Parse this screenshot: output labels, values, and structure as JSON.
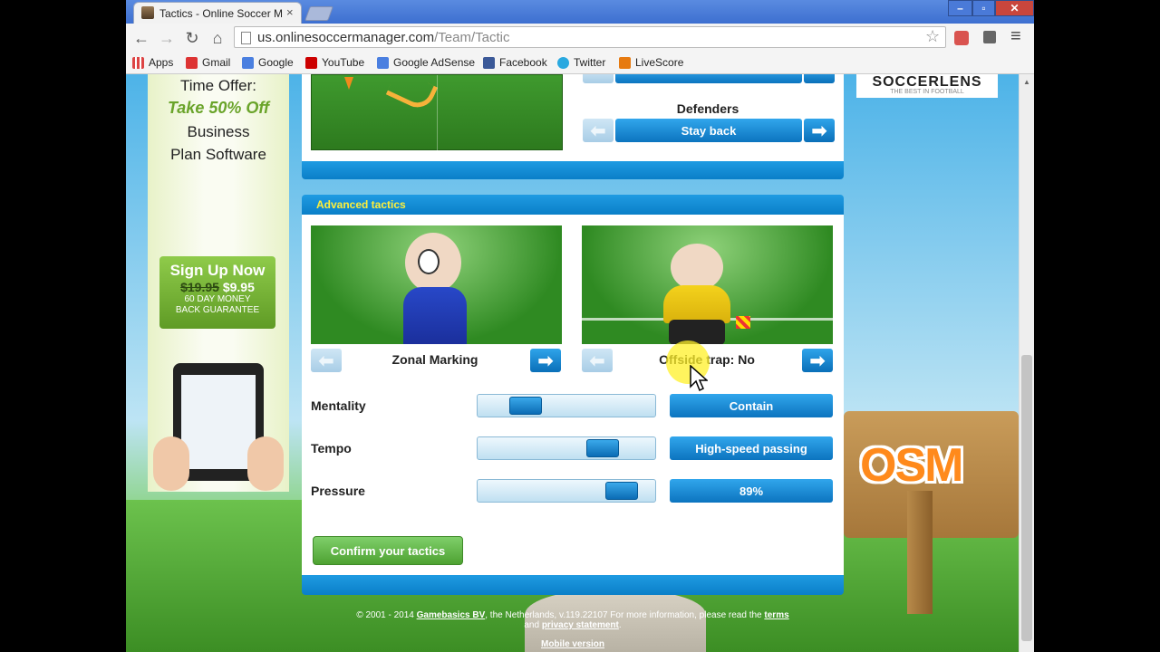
{
  "browser": {
    "tab_title": "Tactics - Online Soccer M",
    "tab_close": "×",
    "url_host": "us.onlinesoccermanager.com",
    "url_path": "/Team/Tactic",
    "win_minimize": "–",
    "win_restore": "▫",
    "win_close": "✕",
    "nav_back": "←",
    "nav_forward": "→",
    "nav_reload": "↻",
    "nav_home": "⌂",
    "star": "☆",
    "menu": "≡",
    "bookmarks": [
      {
        "label": "Apps",
        "icon": "apps-icon",
        "color": "#d44"
      },
      {
        "label": "Gmail",
        "icon": "gmail-icon",
        "color": "#d33"
      },
      {
        "label": "Google",
        "icon": "google-icon",
        "color": "#4a7fe0"
      },
      {
        "label": "YouTube",
        "icon": "youtube-icon",
        "color": "#c00"
      },
      {
        "label": "Google AdSense",
        "icon": "adsense-icon",
        "color": "#4a7fe0"
      },
      {
        "label": "Facebook",
        "icon": "facebook-icon",
        "color": "#3b5998"
      },
      {
        "label": "Twitter",
        "icon": "twitter-icon",
        "color": "#2aa9e0"
      },
      {
        "label": "LiveScore",
        "icon": "livescore-icon",
        "color": "#e67a10"
      }
    ]
  },
  "ad": {
    "line1": "Time Offer:",
    "line2": "Take 50% Off",
    "line3": "Business",
    "line4": "Plan Software",
    "signup": "Sign Up Now",
    "old_price": "$19.95",
    "new_price": "$9.95",
    "guarantee1": "60 DAY MONEY",
    "guarantee2": "BACK GUARANTEE"
  },
  "sponsor": {
    "name": "SOCCERLENS",
    "tagline": "THE BEST IN FOOTBALL"
  },
  "brand": {
    "logo": "OSM"
  },
  "defenders": {
    "label": "Defenders",
    "value": "Stay back"
  },
  "advanced": {
    "title": "Advanced tactics",
    "marking": "Zonal Marking",
    "offside": "Offside trap: No",
    "rows": [
      {
        "label": "Mentality",
        "value": "Contain",
        "level": 0.2
      },
      {
        "label": "Tempo",
        "value": "High-speed passing",
        "level": 0.75
      },
      {
        "label": "Pressure",
        "value": "89%",
        "level": 0.89
      }
    ],
    "confirm": "Confirm your tactics"
  },
  "footer": {
    "prefix": "© 2001 - 2014",
    "company": "Gamebasics BV",
    "middle": ", the Netherlands, v.119.22107 For more information, please read the",
    "terms": "terms",
    "and": "and",
    "privacy": "privacy statement",
    "mobile": "Mobile version"
  },
  "colors": {
    "accent": "#0a7fc8",
    "confirm": "#5cb85c",
    "title_yellow": "#ffef3a"
  }
}
